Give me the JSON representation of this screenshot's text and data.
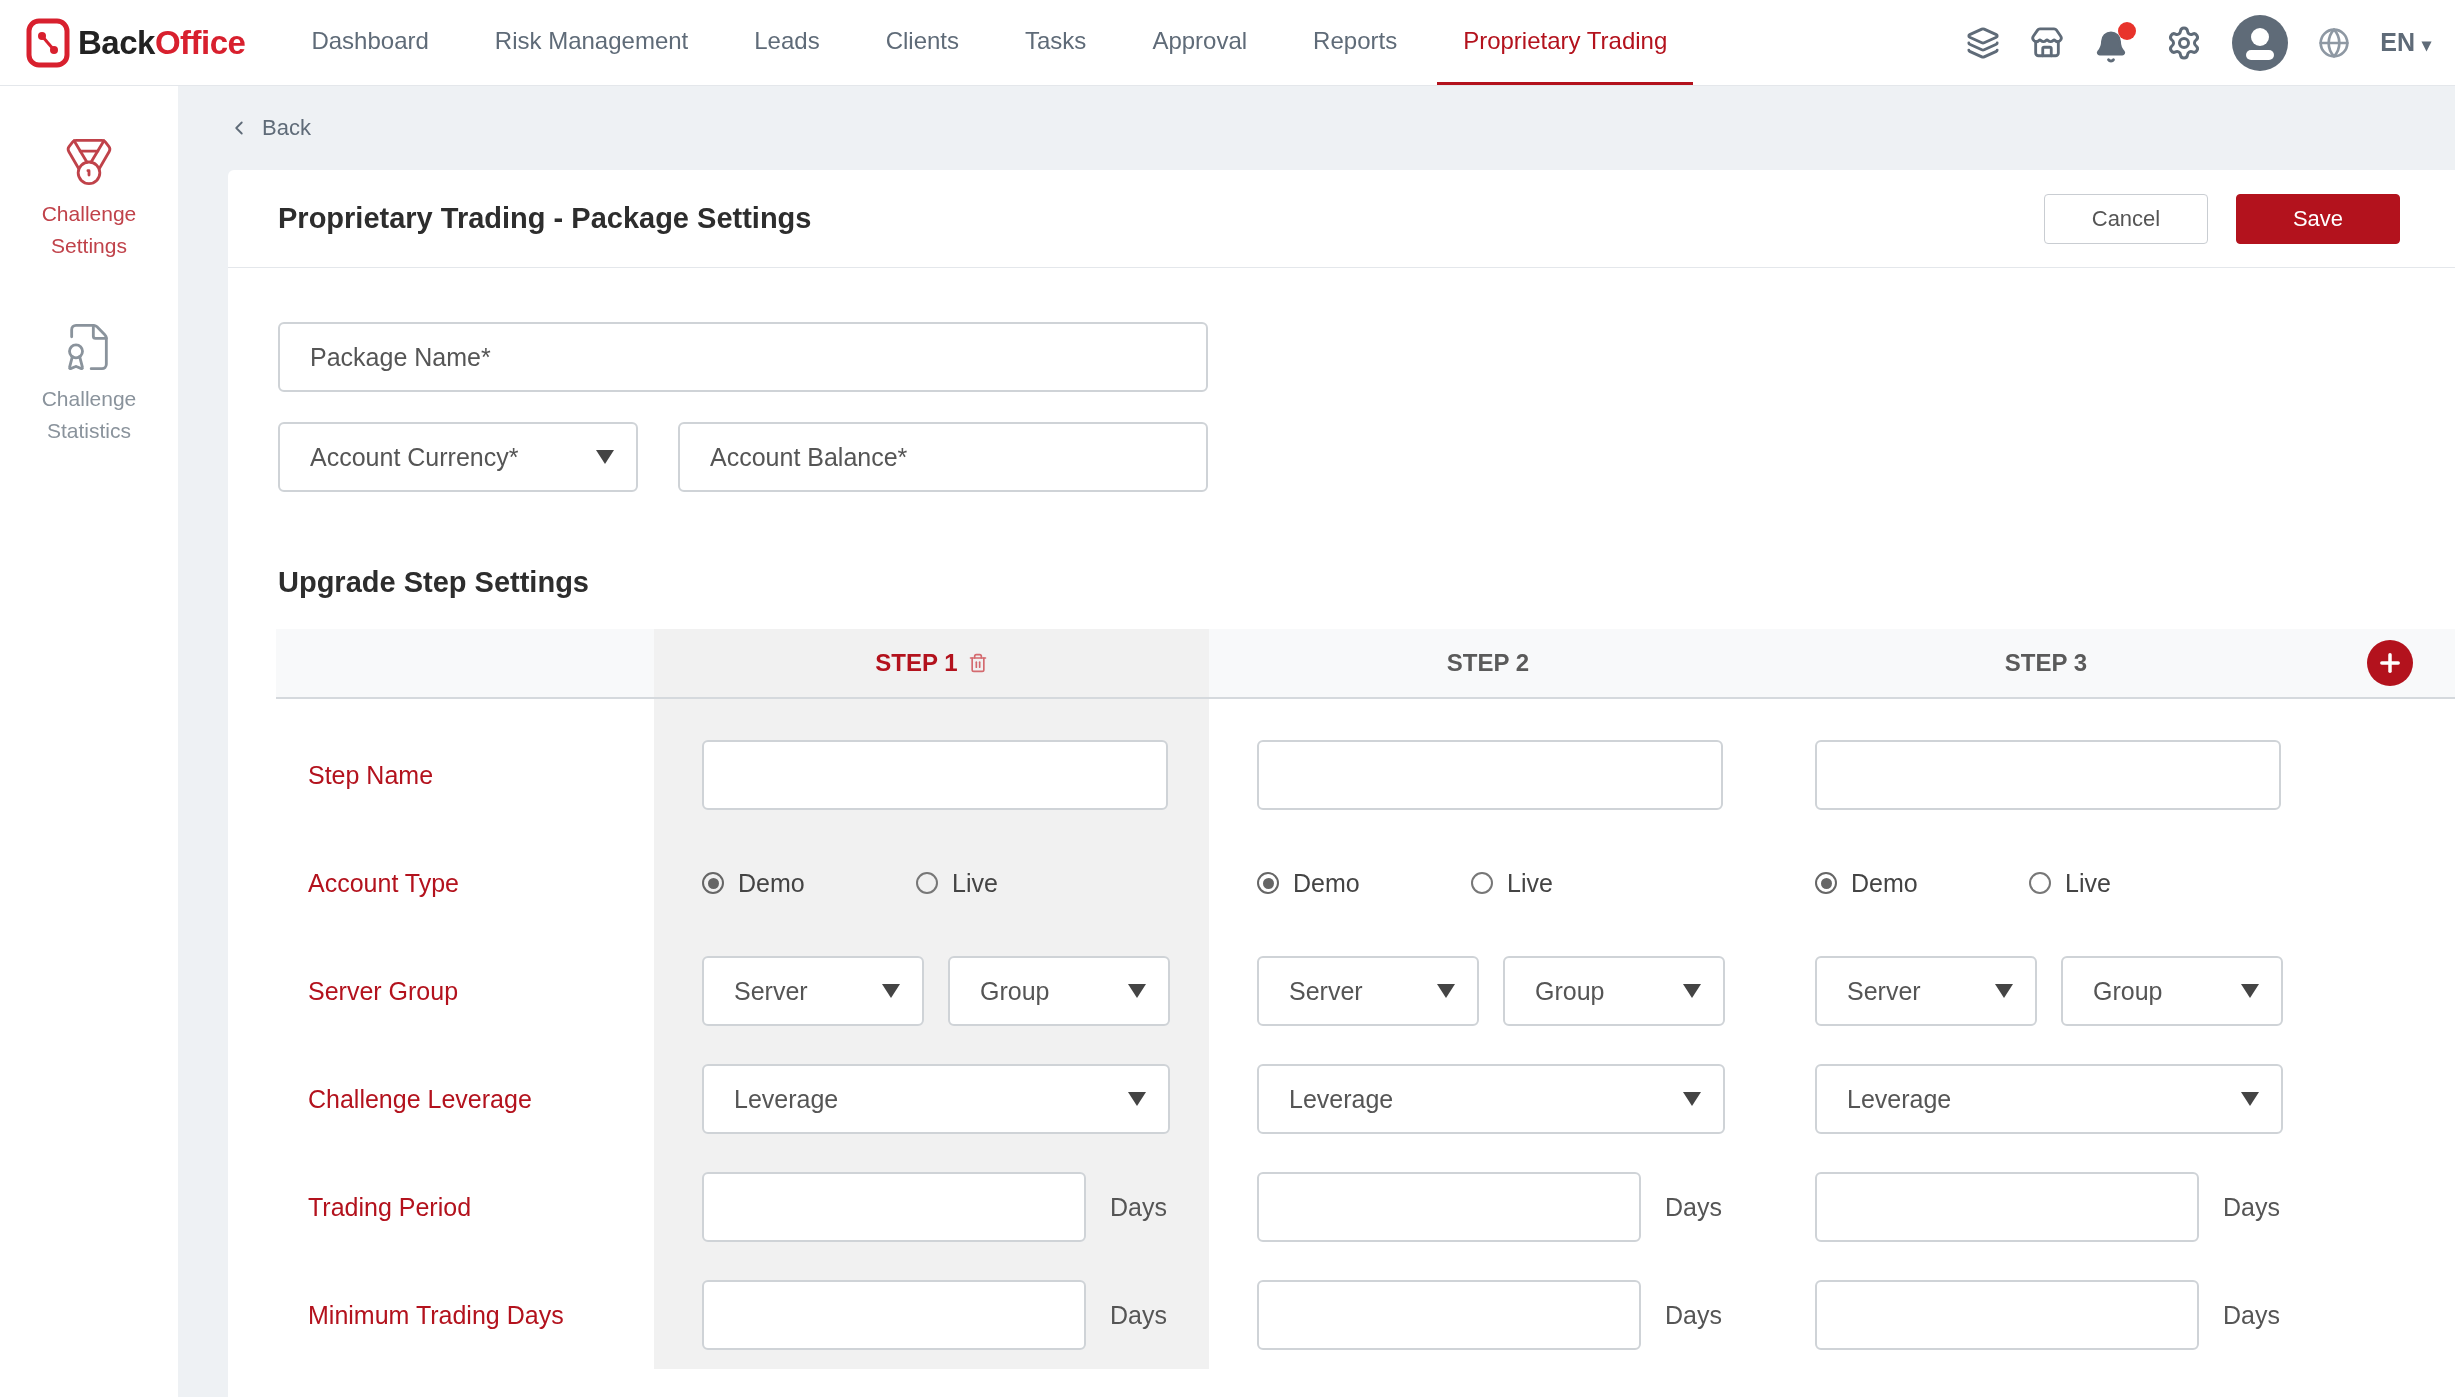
{
  "logo": {
    "part_1": "Back",
    "part_2": "Office"
  },
  "nav": [
    {
      "label": "Dashboard",
      "selected": false
    },
    {
      "label": "Risk Management",
      "selected": false
    },
    {
      "label": "Leads",
      "selected": false
    },
    {
      "label": "Clients",
      "selected": false
    },
    {
      "label": "Tasks",
      "selected": false
    },
    {
      "label": "Approval",
      "selected": false
    },
    {
      "label": "Reports",
      "selected": false
    },
    {
      "label": "Proprietary Trading",
      "selected": true
    }
  ],
  "notifications": {
    "unread": true
  },
  "language": "EN",
  "language_caret": "▾",
  "sidebar": {
    "items": [
      {
        "label": "Challenge Settings",
        "selected": true,
        "kind": "medal"
      },
      {
        "label": "Challenge Statistics",
        "selected": false,
        "kind": "certificate"
      }
    ]
  },
  "back": "Back",
  "page": {
    "title": "Proprietary Trading - Package Settings",
    "buttons": {
      "cancel": "Cancel",
      "save": "Save"
    }
  },
  "fields": {
    "package_name": {
      "placeholder": "Package Name*"
    },
    "account_currency": {
      "placeholder": "Account Currency*"
    },
    "account_balance": {
      "placeholder": "Account Balance*"
    }
  },
  "section_title": "Upgrade Step Settings",
  "steps": [
    {
      "label": "STEP 1",
      "selected": true,
      "removable": true
    },
    {
      "label": "STEP 2",
      "selected": false,
      "removable": false
    },
    {
      "label": "STEP 3",
      "selected": false,
      "removable": false
    }
  ],
  "rows": [
    {
      "label": "Step Name",
      "kind": "text"
    },
    {
      "label": "Account Type",
      "kind": "radio",
      "cells": [
        {
          "options": [
            {
              "label": "Demo",
              "selected": true
            },
            {
              "label": "Live",
              "selected": false
            }
          ]
        },
        {
          "options": [
            {
              "label": "Demo",
              "selected": true
            },
            {
              "label": "Live",
              "selected": false
            }
          ]
        },
        {
          "options": [
            {
              "label": "Demo",
              "selected": true
            },
            {
              "label": "Live",
              "selected": false
            }
          ]
        }
      ]
    },
    {
      "label": "Server Group",
      "kind": "select_pair",
      "cells": [
        {
          "first": "Server",
          "second": "Group"
        },
        {
          "first": "Server",
          "second": "Group"
        },
        {
          "first": "Server",
          "second": "Group"
        }
      ]
    },
    {
      "label": "Challenge Leverage",
      "kind": "select",
      "cells": [
        {
          "placeholder": "Leverage"
        },
        {
          "placeholder": "Leverage"
        },
        {
          "placeholder": "Leverage"
        }
      ]
    },
    {
      "label": "Trading Period",
      "kind": "days",
      "cells": [
        {
          "unit": "Days"
        },
        {
          "unit": "Days"
        },
        {
          "unit": "Days"
        }
      ]
    },
    {
      "label": "Minimum Trading Days",
      "kind": "days",
      "cells": [
        {
          "unit": "Days"
        },
        {
          "unit": "Days"
        },
        {
          "unit": "Days"
        }
      ]
    }
  ]
}
